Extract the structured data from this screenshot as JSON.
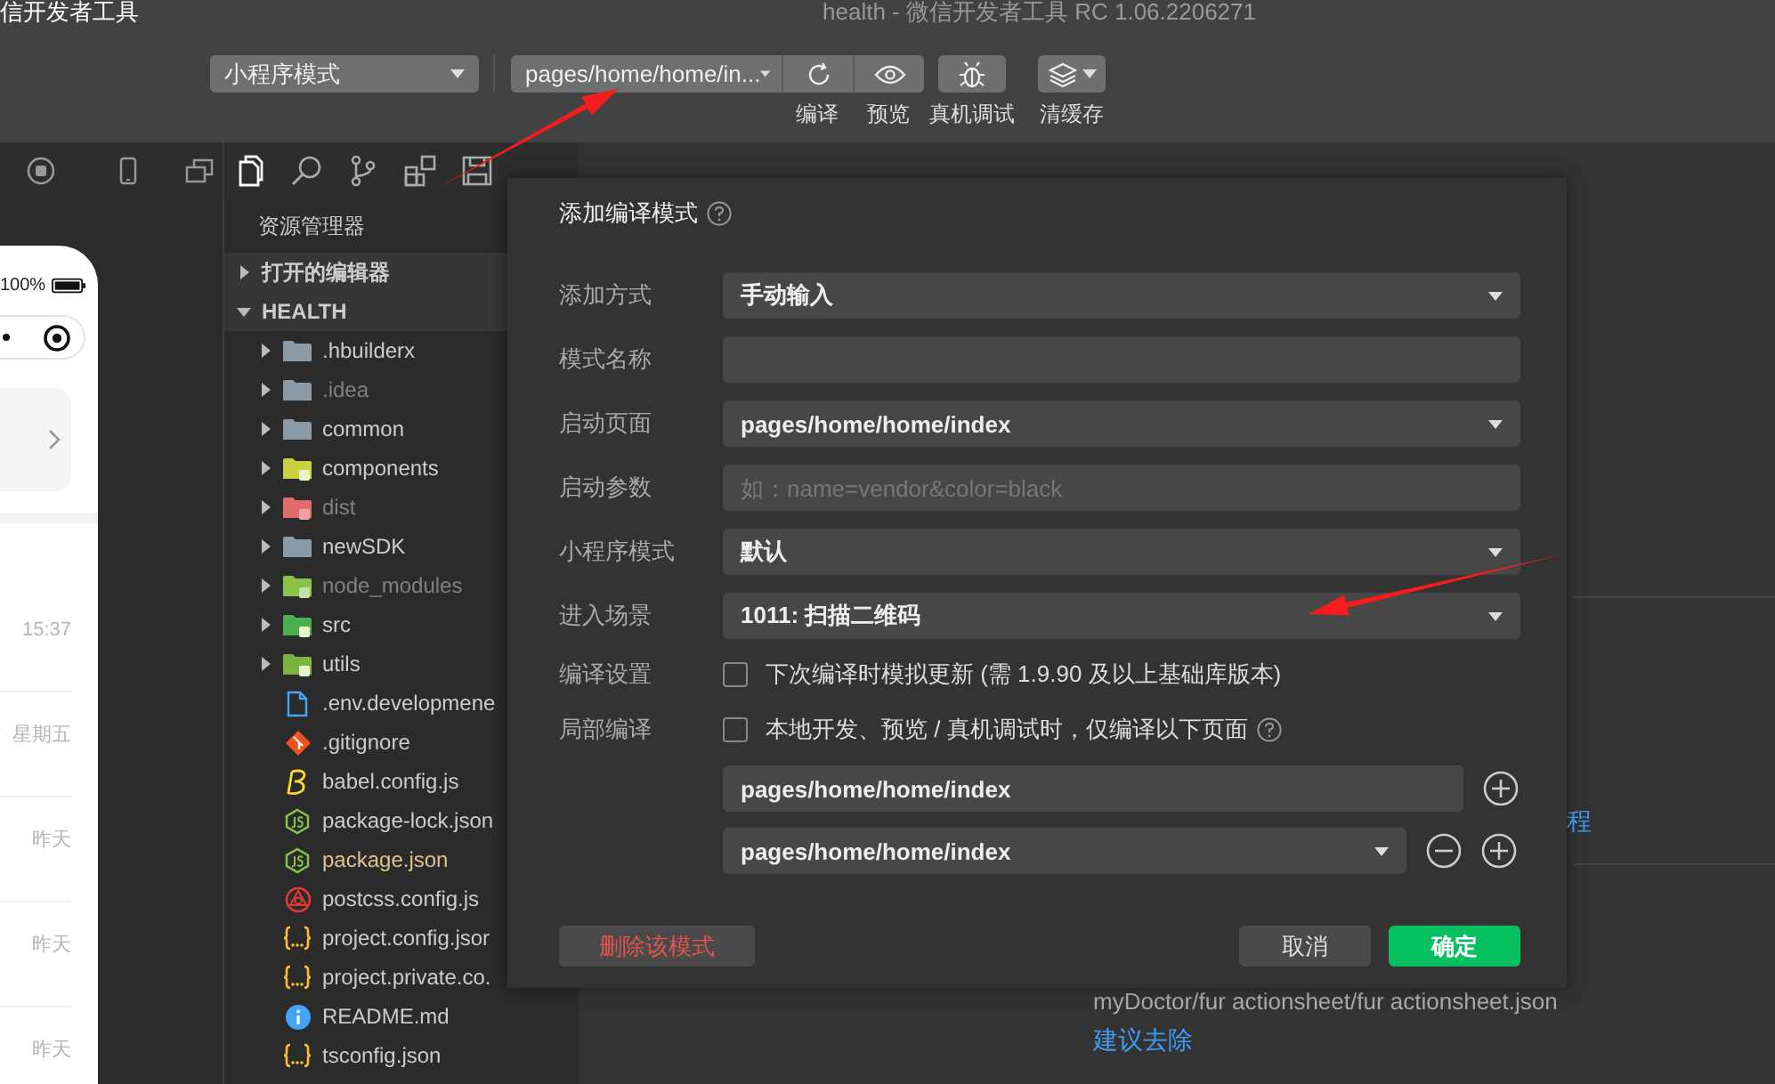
{
  "title_bar": {
    "app_name": "信开发者工具",
    "title": "health - 微信开发者工具 RC 1.06.2206271"
  },
  "toolbar": {
    "mode_select": "小程序模式",
    "compile_select": "pages/home/home/in...",
    "buttons": [
      {
        "label": "编译",
        "kind": "compile"
      },
      {
        "label": "预览",
        "kind": "preview"
      },
      {
        "label": "真机调试",
        "kind": "debug"
      },
      {
        "label": "清缓存",
        "kind": "cache"
      }
    ]
  },
  "simulator": {
    "battery": "100%",
    "chat_times": [
      "15:37",
      "星期五",
      "昨天",
      "昨天",
      "昨天"
    ]
  },
  "explorer": {
    "title": "资源管理器",
    "sections": [
      {
        "label": "打开的编辑器",
        "expanded": false
      },
      {
        "label": "HEALTH",
        "expanded": true
      }
    ],
    "folders": [
      {
        "name": ".hbuilderx",
        "kind": "plain",
        "expanded": false,
        "dimmed": false
      },
      {
        "name": ".idea",
        "kind": "plain",
        "expanded": false,
        "dimmed": true
      },
      {
        "name": "common",
        "kind": "plain",
        "expanded": false,
        "dimmed": false
      },
      {
        "name": "components",
        "kind": "components",
        "expanded": false,
        "dimmed": false
      },
      {
        "name": "dist",
        "kind": "dist",
        "expanded": false,
        "dimmed": true
      },
      {
        "name": "newSDK",
        "kind": "plain",
        "expanded": false,
        "dimmed": false
      },
      {
        "name": "node_modules",
        "kind": "node",
        "expanded": false,
        "dimmed": true
      },
      {
        "name": "src",
        "kind": "src",
        "expanded": false,
        "dimmed": false
      },
      {
        "name": "utils",
        "kind": "utils",
        "expanded": false,
        "dimmed": false
      }
    ],
    "files": [
      {
        "name": ".env.developmene",
        "kind": "env",
        "modified": false
      },
      {
        "name": ".gitignore",
        "kind": "git",
        "modified": false
      },
      {
        "name": "babel.config.js",
        "kind": "babel",
        "modified": false
      },
      {
        "name": "package-lock.json",
        "kind": "node",
        "modified": false
      },
      {
        "name": "package.json",
        "kind": "node",
        "modified": true
      },
      {
        "name": "postcss.config.js",
        "kind": "postcss",
        "modified": false
      },
      {
        "name": "project.config.jsor",
        "kind": "braces",
        "modified": false
      },
      {
        "name": "project.private.co.",
        "kind": "braces",
        "modified": false
      },
      {
        "name": "README.md",
        "kind": "info",
        "modified": false
      },
      {
        "name": "tsconfig.json",
        "kind": "braces",
        "modified": false
      }
    ]
  },
  "editor": {
    "tutorial_link": "程",
    "file_path": "myDoctor/fur actionsheet/fur actionsheet.json",
    "suggestion_link": "建议去除"
  },
  "dialog": {
    "title": "添加编译模式",
    "fields": [
      {
        "label": "添加方式",
        "kind": "select",
        "value": "手动输入"
      },
      {
        "label": "模式名称",
        "kind": "input"
      },
      {
        "label": "启动页面",
        "kind": "select",
        "value": "pages/home/home/index"
      },
      {
        "label": "启动参数",
        "kind": "input",
        "placeholder": "如：name=vendor&color=black"
      },
      {
        "label": "小程序模式",
        "kind": "select",
        "value": "默认"
      },
      {
        "label": "进入场景",
        "kind": "select",
        "value": "1011: 扫描二维码"
      }
    ],
    "options": [
      {
        "label": "编译设置",
        "text": "下次编译时模拟更新 (需 1.9.90 及以上基础库版本)",
        "checked": false,
        "help": false
      },
      {
        "label": "局部编译",
        "text": "本地开发、预览 / 真机调试时，仅编译以下页面",
        "checked": false,
        "help": true
      }
    ],
    "pages": [
      {
        "value": "pages/home/home/index",
        "kind": "input"
      },
      {
        "value": "pages/home/home/index",
        "kind": "select"
      }
    ],
    "buttons": [
      {
        "label": "删除该模式",
        "kind": "danger"
      },
      {
        "label": "取消",
        "kind": "secondary"
      },
      {
        "label": "确定",
        "kind": "primary"
      }
    ]
  }
}
